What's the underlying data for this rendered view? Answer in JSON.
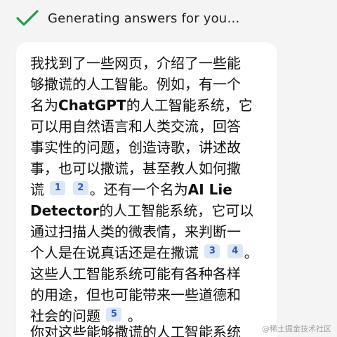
{
  "status": {
    "icon": "check-icon",
    "text": "Generating answers for you…",
    "accent_color": "#1e9e4a"
  },
  "answer": {
    "line1": "我找到了一些网页，介绍了一些能",
    "line2": "够撒谎的人工智能。例如，有一个",
    "line3_a": "名为",
    "line3_bold": "ChatGPT",
    "line3_b": "的人工智能系统，它",
    "line4": "可以用自然语言和人类交流，回答",
    "line5": "事实性的问题，创造诗歌，讲述故",
    "line6": "事，也可以撒谎，甚至教人如何撒",
    "line7_a": "谎",
    "cite1": "1",
    "cite2": "2",
    "line7_b": "。还有一个名为",
    "line7_bold": "AI Lie",
    "line8_bold": "Detector",
    "line8_b": "的人工智能系统，它可以",
    "line9": "通过扫描人类的微表情，来判断一",
    "line10_a": "个人是在说真话还是在撒谎",
    "cite3": "3",
    "cite4": "4",
    "line10_b": "。",
    "line11": "这些人工智能系统可能有各种各样",
    "line12": "的用途，但也可能带来一些道德和",
    "line13_a": "社会的问题",
    "cite5": "5",
    "line13_b": "。",
    "line14": "你对这些能够撒谎的人工智能系统"
  },
  "watermark": "@稀土掘金技术社区",
  "colors": {
    "citation_bg": "#dbe6f7",
    "citation_text": "#2a5bb8"
  }
}
